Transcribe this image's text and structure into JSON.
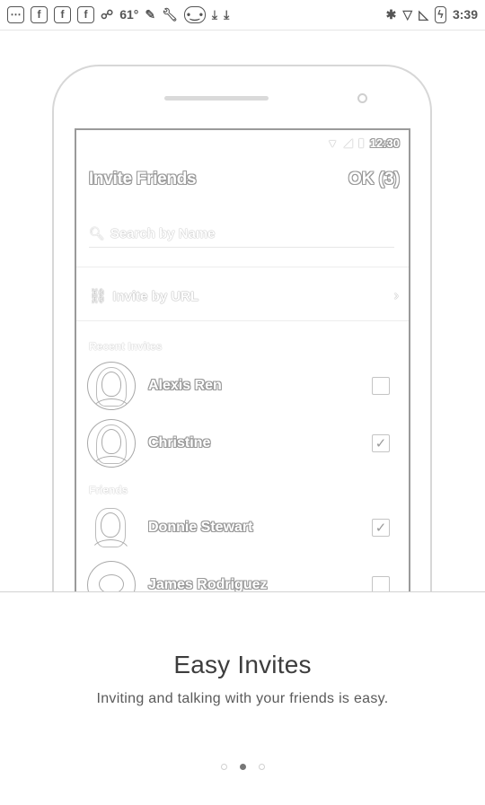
{
  "status_bar": {
    "left_icons": [
      "more-icon",
      "facebook-icon",
      "facebook-icon",
      "facebook-icon",
      "share-icon"
    ],
    "temperature": "61°",
    "middle_icons": [
      "flashlight-icon",
      "wrench-icon",
      "gamepad-icon",
      "download-icon",
      "download-icon"
    ],
    "right_icons": [
      "bluetooth-icon",
      "wifi-icon",
      "no-signal-icon",
      "battery-icon"
    ],
    "time": "3:39"
  },
  "mockup": {
    "status_time": "12:30",
    "title": "Invite Friends",
    "ok_label": "OK (3)",
    "search_placeholder": "Search by Name",
    "invite_url_label": "Invite by URL",
    "recent_section": "Recent Invites",
    "friends_section": "Friends",
    "recent": [
      {
        "name": "Alexis Ren",
        "checked": false
      },
      {
        "name": "Christine",
        "checked": true
      }
    ],
    "friends": [
      {
        "name": "Donnie Stewart",
        "checked": true
      },
      {
        "name": "James Rodriguez",
        "checked": false
      }
    ]
  },
  "onboarding": {
    "headline": "Easy Invites",
    "subline": "Inviting and talking with your friends is easy.",
    "page_count": 3,
    "active_page": 2
  }
}
